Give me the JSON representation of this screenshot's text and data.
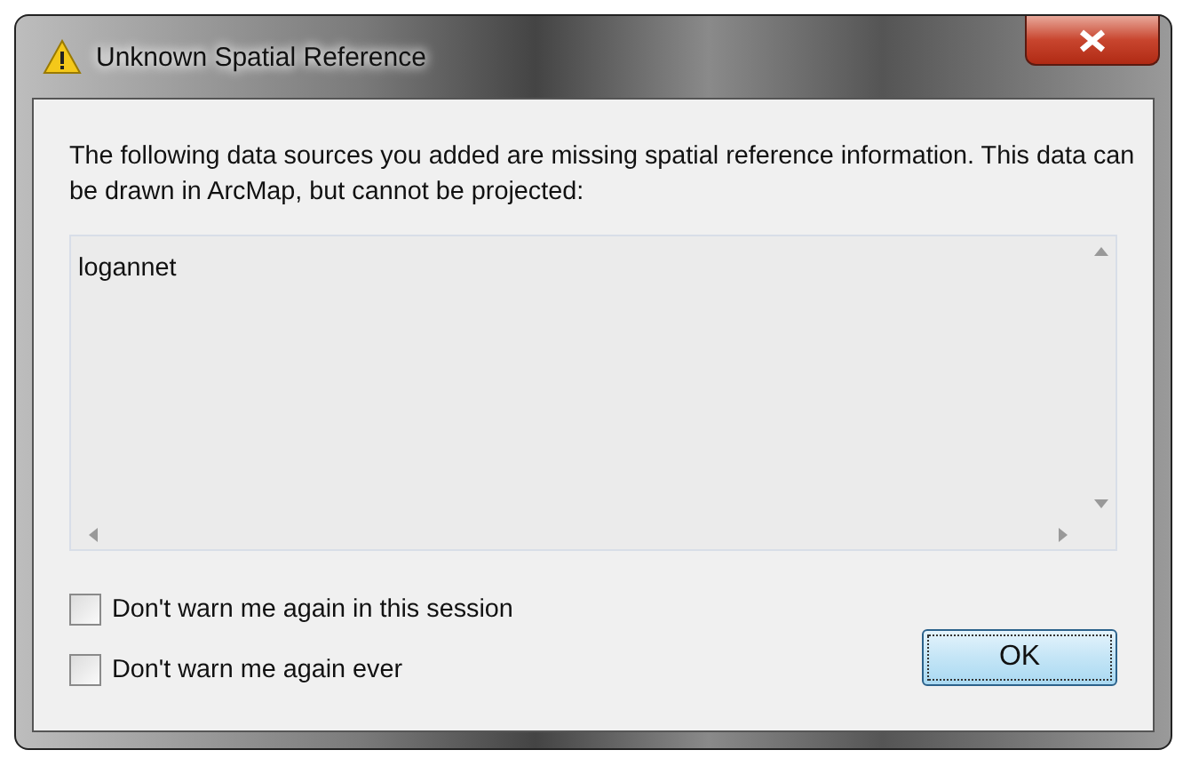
{
  "window": {
    "title": "Unknown Spatial Reference"
  },
  "message": "The following data sources you added are missing spatial reference information. This data can be drawn in ArcMap, but cannot be projected:",
  "sources": [
    "logannet"
  ],
  "checkboxes": [
    {
      "label": "Don't warn me again in this session",
      "checked": false
    },
    {
      "label": "Don't warn me again ever",
      "checked": false
    }
  ],
  "buttons": [
    "OK"
  ]
}
